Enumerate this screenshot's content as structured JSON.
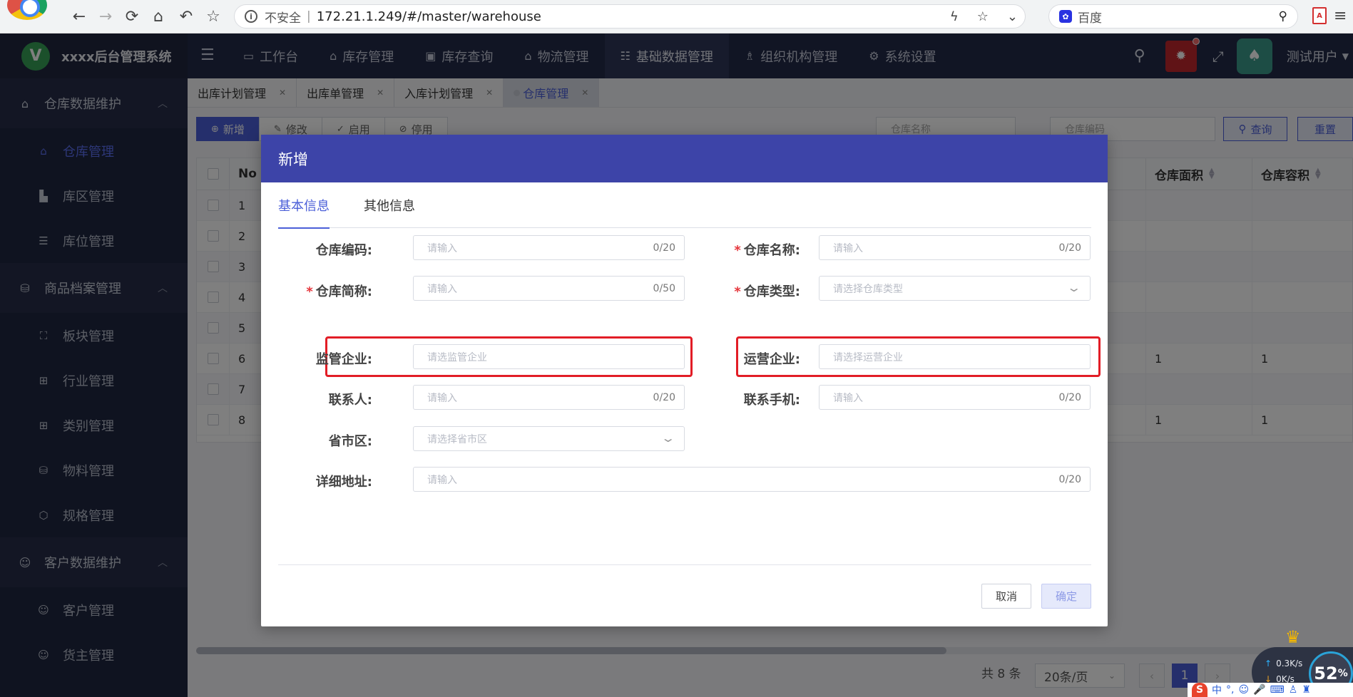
{
  "browser": {
    "insecure_label": "不安全",
    "separator": "|",
    "url": "172.21.1.249/#/master/warehouse",
    "search_engine": "百度"
  },
  "app": {
    "logo_letter": "V",
    "title": "xxxx后台管理系统"
  },
  "sidebar": {
    "groups": [
      {
        "label": "仓库数据维护",
        "items": [
          {
            "label": "仓库管理"
          },
          {
            "label": "库区管理"
          },
          {
            "label": "库位管理"
          }
        ]
      },
      {
        "label": "商品档案管理",
        "items": [
          {
            "label": "板块管理"
          },
          {
            "label": "行业管理"
          },
          {
            "label": "类别管理"
          },
          {
            "label": "物料管理"
          },
          {
            "label": "规格管理"
          }
        ]
      },
      {
        "label": "客户数据维护",
        "items": [
          {
            "label": "客户管理"
          },
          {
            "label": "货主管理"
          }
        ]
      }
    ]
  },
  "topnav": {
    "items": [
      {
        "label": "工作台"
      },
      {
        "label": "库存管理"
      },
      {
        "label": "库存查询"
      },
      {
        "label": "物流管理"
      },
      {
        "label": "基础数据管理"
      },
      {
        "label": "组织机构管理"
      },
      {
        "label": "系统设置"
      }
    ],
    "username": "测试用户"
  },
  "tabs": [
    {
      "label": "出库计划管理"
    },
    {
      "label": "出库单管理"
    },
    {
      "label": "入库计划管理"
    },
    {
      "label": "仓库管理"
    }
  ],
  "toolbar": {
    "add": "新增",
    "edit": "修改",
    "enable": "启用",
    "disable": "停用",
    "filter_name_placeholder": "仓库名称",
    "filter_code_placeholder": "仓库编码",
    "query": "查询",
    "reset": "重置"
  },
  "table": {
    "headers": {
      "no": "No",
      "area": "仓库面积",
      "capacity": "仓库容积"
    },
    "rows": [
      {
        "no": "1",
        "area": "",
        "capacity": ""
      },
      {
        "no": "2",
        "area": "",
        "capacity": ""
      },
      {
        "no": "3",
        "area": "",
        "capacity": ""
      },
      {
        "no": "4",
        "area": "",
        "capacity": ""
      },
      {
        "no": "5",
        "area": "",
        "capacity": ""
      },
      {
        "no": "6",
        "area": "1",
        "capacity": "1"
      },
      {
        "no": "7",
        "area": "",
        "capacity": ""
      },
      {
        "no": "8",
        "area": "1",
        "capacity": "1"
      }
    ]
  },
  "pagination": {
    "total": "共 8 条",
    "page_size": "20条/页",
    "current": "1"
  },
  "modal": {
    "title": "新增",
    "tabs": {
      "basic": "基本信息",
      "other": "其他信息"
    },
    "fields": {
      "code": {
        "label": "仓库编码:",
        "placeholder": "请输入",
        "count": "0/20"
      },
      "name": {
        "label": "仓库名称:",
        "placeholder": "请输入",
        "count": "0/20"
      },
      "short_name": {
        "label": "仓库简称:",
        "placeholder": "请输入",
        "count": "0/50"
      },
      "type": {
        "label": "仓库类型:",
        "placeholder": "请选择仓库类型"
      },
      "supervisor": {
        "label": "监管企业:",
        "placeholder": "请选监管企业"
      },
      "operator": {
        "label": "运营企业:",
        "placeholder": "请选择运营企业"
      },
      "contact": {
        "label": "联系人:",
        "placeholder": "请输入",
        "count": "0/20"
      },
      "phone": {
        "label": "联系手机:",
        "placeholder": "请输入",
        "count": "0/20"
      },
      "region": {
        "label": "省市区:",
        "placeholder": "请选择省市区"
      },
      "address": {
        "label": "详细地址:",
        "placeholder": "请输入",
        "count": "0/20"
      }
    },
    "required_mark": "*",
    "cancel": "取消",
    "confirm": "确定"
  },
  "system_tray": {
    "upload_speed": "0.3K/s",
    "download_speed": "0K/s",
    "usage_percent": "52",
    "percent_sign": "%",
    "ime_label": "中"
  }
}
